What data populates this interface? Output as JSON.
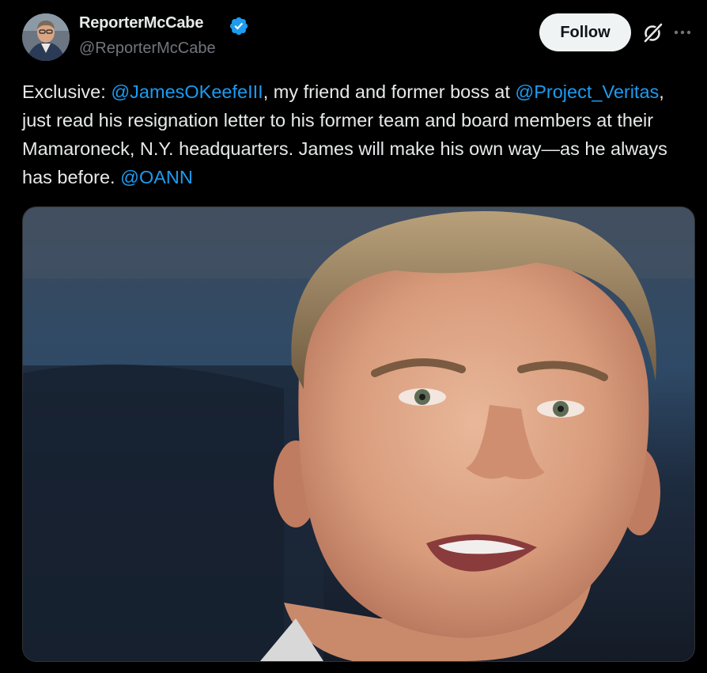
{
  "author": {
    "display_name": "ReporterMcCabe",
    "handle": "@ReporterMcCabe",
    "verified": true,
    "verified_icon": "verified-badge-icon",
    "avatar_icon": "avatar"
  },
  "header": {
    "follow_label": "Follow",
    "grok_icon": "grok-icon",
    "more_icon": "more-icon"
  },
  "tweet": {
    "parts": {
      "p1": "Exclusive: ",
      "mention1": "@JamesOKeefeIII",
      "p2": ", my friend and former boss at ",
      "mention2": "@Project_Veritas",
      "p3": ", just read his resignation letter to his former team and board members at their Mamaroneck, N.Y. headquarters. James will make his own way—as he always has before. ",
      "mention3": "@OANN"
    }
  },
  "media": {
    "type": "photo"
  },
  "colors": {
    "background": "#000000",
    "text": "#e7e9ea",
    "secondary_text": "#71767b",
    "link": "#1d9bf0",
    "follow_button_bg": "#eff3f4",
    "verified": "#1d9bf0"
  }
}
